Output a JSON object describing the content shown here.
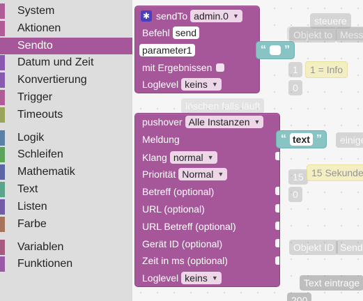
{
  "toolbox": {
    "categories": [
      {
        "label": "System",
        "color": "#b05d97"
      },
      {
        "label": "Aktionen",
        "color": "#b05d97"
      },
      {
        "label": "Sendto",
        "color": "#a5579a",
        "selected": true
      },
      {
        "label": "Datum und Zeit",
        "color": "#8a5ab0"
      },
      {
        "label": "Konvertierung",
        "color": "#8a5ab0"
      },
      {
        "label": "Trigger",
        "color": "#b05d97"
      },
      {
        "label": "Timeouts",
        "color": "#9aa45a"
      },
      {
        "label": "Logik",
        "color": "#5b80a5"
      },
      {
        "label": "Schleifen",
        "color": "#5ba55b"
      },
      {
        "label": "Mathematik",
        "color": "#5b67a5"
      },
      {
        "label": "Text",
        "color": "#5ba58c"
      },
      {
        "label": "Listen",
        "color": "#745ba5"
      },
      {
        "label": "Farbe",
        "color": "#a5745b"
      },
      {
        "label": "Variablen",
        "color": "#a55b80"
      },
      {
        "label": "Funktionen",
        "color": "#995ba5"
      }
    ]
  },
  "workspace": {
    "ghosts": {
      "steuere": "steuere",
      "objekt_to": "Objekt to",
      "mess": "Mess",
      "num1": "1",
      "info": "1 = Info",
      "num0a": "0",
      "loschen": "löschen falls läuft",
      "einige": "einige",
      "num15": "15",
      "sekunde": "15 Sekunde",
      "num0b": "0",
      "objekt_id": "Objekt ID",
      "send": "Send",
      "text_eintrag": "Text eintrage",
      "num200": "200"
    },
    "sendto_block": {
      "title": "sendTo",
      "instance": "admin.0",
      "befehl_label": "Befehl",
      "befehl_value": "send",
      "parameter_value": "parameter1",
      "ergebnisse_label": "mit Ergebnissen",
      "loglevel_label": "Loglevel",
      "loglevel_value": "keins"
    },
    "empty_string_block": {
      "open_quote": "“",
      "close_quote": "”",
      "value": ""
    },
    "pushover_block": {
      "title": "pushover",
      "instances": "Alle Instanzen",
      "meldung_label": "Meldung",
      "klang_label": "Klang",
      "klang_value": "normal",
      "prioritaet_label": "Priorität",
      "prioritaet_value": "Normal",
      "betreff_label": "Betreff (optional)",
      "url_label": "URL (optional)",
      "url_betreff_label": "URL Betreff (optional)",
      "geraet_label": "Gerät ID (optional)",
      "zeit_label": "Zeit in ms (optional)",
      "loglevel_label": "Loglevel",
      "loglevel_value": "keins"
    },
    "text_string_block": {
      "open_quote": "“",
      "close_quote": "”",
      "value": "text"
    }
  }
}
